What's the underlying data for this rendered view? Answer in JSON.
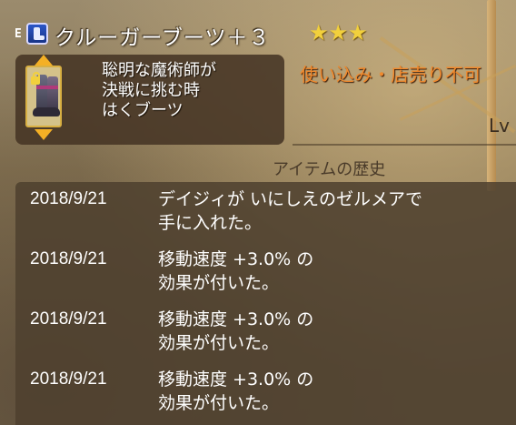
{
  "header": {
    "slot_tag": "E",
    "type_icon": "boots-icon",
    "item_name": "クルーガーブーツ＋３",
    "stars": "★★★",
    "star_count": 3
  },
  "detail": {
    "lock_icon": "lock-icon",
    "description_lines": [
      "聡明な魔術師が",
      "決戦に挑む時",
      "はくブーツ"
    ]
  },
  "restriction": "使い込み・店売り不可",
  "level_label": "Lv",
  "history": {
    "title": "アイテムの歴史",
    "entries": [
      {
        "date": "2018/9/21",
        "lines": [
          "デイジィが いにしえのゼルメアで",
          "手に入れた。"
        ]
      },
      {
        "date": "2018/9/21",
        "lines": [
          "移動速度 +3.0% の",
          "効果が付いた。"
        ]
      },
      {
        "date": "2018/9/21",
        "lines": [
          "移動速度 +3.0% の",
          "効果が付いた。"
        ]
      },
      {
        "date": "2018/9/21",
        "lines": [
          "移動速度 +3.0% の",
          "効果が付いた。"
        ]
      }
    ]
  },
  "colors": {
    "name_text": "#ffffff",
    "star": "#f2d03c",
    "restriction": "#f08a2e",
    "arrow": "#f4b025",
    "panel": "#4e402e"
  }
}
